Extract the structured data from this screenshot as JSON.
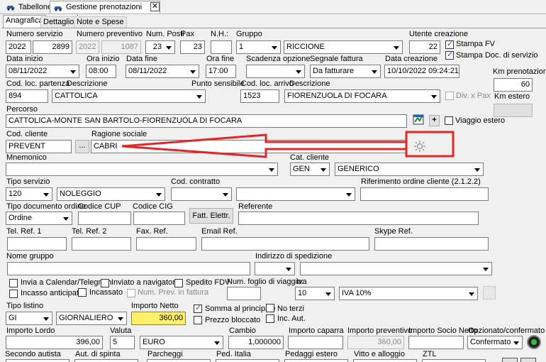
{
  "app_tabs": [
    "Tabellone",
    "Gestione prenotazioni varia"
  ],
  "sub_tabs": [
    "Anagrafica",
    "Dettaglio",
    "Note e Spese"
  ],
  "labels": {
    "numero_servizio": "Numero servizio",
    "numero_preventivo": "Numero preventivo",
    "num_posti": "Num. Posti",
    "pax": "Pax",
    "nh": "N.H.:",
    "gruppo": "Gruppo",
    "utente_creazione": "Utente creazione",
    "stampa_fv": "Stampa FV",
    "stampa_doc": "Stampa Doc. di servizio",
    "data_inizio": "Data inizio",
    "ora_inizio": "Ora inizio",
    "data_fine": "Data fine",
    "ora_fine": "Ora fine",
    "scadenza_opzione": "Scadenza opzione",
    "segnale_fattura": "Segnale fattura",
    "data_creazione": "Data creazione",
    "km_prenotazione": "Km prenotazione",
    "cod_loc_partenza": "Cod. loc. partenza",
    "descrizione": "Descrizione",
    "punto_sensibile": "Punto sensibile",
    "cod_loc_arrivo": "Cod. loc. arrivo",
    "descrizione2": "Descrizione",
    "div_pax": "Div. x Pax",
    "km_estero": "Km estero",
    "percorso": "Percorso",
    "viaggio_estero": "Viaggio estero",
    "cod_cliente": "Cod. cliente",
    "ragione_sociale": "Ragione sociale",
    "mnemonico": "Mnemonico",
    "cat_cliente": "Cat. cliente",
    "tipo_servizio": "Tipo servizio",
    "cod_contratto": "Cod. contratto",
    "riferimento_ordine": "Riferimento ordine cliente (2.1.2.2)",
    "tipo_documento_ordine": "Tipo documento ordine",
    "codice_cup": "Codice CUP",
    "codice_cig": "Codice CIG",
    "fatt_elettr": "Fatt. Elettr.",
    "referente": "Referente",
    "tel_ref1": "Tel. Ref. 1",
    "tel_ref2": "Tel. Ref. 2",
    "fax_ref": "Fax. Ref.",
    "email_ref": "Email Ref.",
    "skype_ref": "Skype Ref.",
    "nome_gruppo": "Nome gruppo",
    "indirizzo_spedizione": "Indirizzo di spedizione",
    "invia_calendar": "Invia a Calendar/Telegram",
    "inviato_navigatore": "Inviato a navigatore",
    "spedito_fdv": "Spedito FDV",
    "num_foglio_viaggio": "Num. foglio di viaggio:",
    "iva": "Iva",
    "incasso_anticipato": "Incasso anticipato",
    "incassato": "Incassato",
    "num_prev_fattura": "Num. Prev. in fattura",
    "tipo_listino": "Tipo listino",
    "importo_netto": "Importo Netto",
    "somma_principale": "Somma al principale",
    "no_terzi": "No terzi",
    "prezzo_bloccato": "Prezzo bloccato",
    "inc_aut": "Inc. Aut.",
    "importo_lordo": "Importo Lordo",
    "valuta": "Valuta",
    "cambio": "Cambio",
    "importo_caparra": "Importo caparra",
    "importo_preventivo": "Importo preventivo",
    "importo_socio_netto": "Importo Socio Netto",
    "opzionato_confermato": "Opzionato/confermato",
    "secondo_autista": "Secondo autista",
    "aut_spinta": "Aut. di spinta",
    "parcheggi": "Parcheggi",
    "ped_italia": "Ped. Italia",
    "pedaggi_estero": "Pedaggi estero",
    "vitto_alloggio": "Vitto e alloggio",
    "ztl": "ZTL"
  },
  "values": {
    "numero_servizio_anno": "2022",
    "numero_servizio": "2899",
    "numero_preventivo_anno": "2022",
    "numero_preventivo": "1087",
    "num_posti": "23",
    "pax": "23",
    "nh": "",
    "gruppo_code": "1",
    "gruppo": "RICCIONE",
    "utente_creazione": "22",
    "data_inizio": "08/11/2022",
    "ora_inizio": "08:00",
    "data_fine": "08/11/2022",
    "ora_fine": "17:00",
    "scadenza_opzione": "",
    "segnale_fattura": "Da fatturare",
    "data_creazione": "10/10/2022 09:24:21",
    "km_prenotazione": "60",
    "cod_loc_partenza": "894",
    "desc_partenza": "CATTOLICA",
    "punto_sensibile": "",
    "cod_loc_arrivo": "1523",
    "desc_arrivo": "FIORENZUOLA DI FOCARA",
    "km_estero": "",
    "percorso": "CATTOLICA-MONTE SAN BARTOLO-FIORENZUOLA DI FOCARA",
    "cod_cliente": "PREVENT",
    "cliente_lookup": "...",
    "ragione_sociale": "CABRI",
    "mnemonico": "",
    "cat_cliente_code": "GEN",
    "cat_cliente": "GENERICO",
    "tipo_servizio_code": "120",
    "tipo_servizio": "NOLEGGIO",
    "tipo_documento_ordine": "Ordine",
    "iva_code": "10",
    "iva": "IVA 10%",
    "tipo_listino_code": "GI",
    "tipo_listino": "GIORNALIERO",
    "importo_netto": "360,00",
    "importo_lordo": "396,00",
    "valuta_code": "5",
    "valuta": "EURO",
    "cambio": "1,000000",
    "importo_caparra": "",
    "importo_preventivo": "360,00",
    "importo_socio_netto": "",
    "opzionato_confermato": "Confermato",
    "plus": "+"
  },
  "checks": {
    "stampa_fv": true,
    "stampa_doc": true,
    "div_pax": false,
    "viaggio_estero": false,
    "invia_calendar": false,
    "inviato_navigatore": false,
    "spedito_fdv": false,
    "incasso_anticipato": false,
    "incassato": false,
    "num_prev_fattura": false,
    "somma_principale": true,
    "no_terzi": false,
    "prezzo_bloccato": false,
    "inc_aut": false
  },
  "annotation": {
    "color": "#e0282a"
  }
}
